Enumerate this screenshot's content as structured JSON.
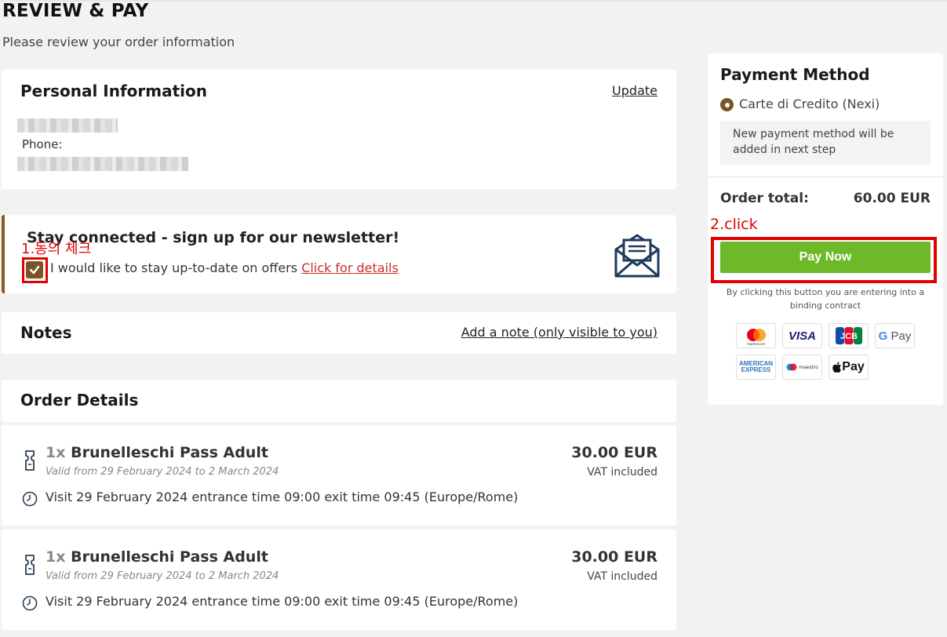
{
  "page": {
    "title": "REVIEW & PAY",
    "subtitle": "Please review your order information"
  },
  "personal": {
    "title": "Personal Information",
    "update_link": "Update",
    "phone_label": "Phone:"
  },
  "newsletter": {
    "title": "Stay connected - sign up for our newsletter!",
    "checkbox_text": "I would like to stay up-to-date on offers",
    "details_link": "Click for details",
    "checked": true
  },
  "notes": {
    "title": "Notes",
    "add_link": "Add a note (only visible to you)"
  },
  "order": {
    "title": "Order Details",
    "items": [
      {
        "qty": "1x",
        "name": "Brunelleschi Pass Adult",
        "validity": "Valid from 29 February 2024 to 2 March 2024",
        "price": "30.00 EUR",
        "vat": "VAT included",
        "visit": "Visit 29 February 2024 entrance time 09:00 exit time 09:45 (Europe/Rome)"
      },
      {
        "qty": "1x",
        "name": "Brunelleschi Pass Adult",
        "validity": "Valid from 29 February 2024 to 2 March 2024",
        "price": "30.00 EUR",
        "vat": "VAT included",
        "visit": "Visit 29 February 2024 entrance time 09:00 exit time 09:45 (Europe/Rome)"
      }
    ]
  },
  "payment": {
    "title": "Payment Method",
    "option": "Carte di Credito (Nexi)",
    "note": "New payment method will be added in next step",
    "total_label": "Order total:",
    "total_value": "60.00 EUR",
    "pay_button": "Pay Now",
    "pay_note": "By clicking this button you are entering into a binding contract",
    "logos": {
      "mastercard_small": "mastercard",
      "visa": "VISA",
      "jcb": "JCB",
      "gpay_g": "G",
      "gpay_text": "Pay",
      "amex_line1": "AMERICAN",
      "amex_line2": "EXPRESS",
      "maestro": "maestro",
      "apple_pay": "Pay"
    }
  },
  "annotations": {
    "step1": "1.동의 체크",
    "step2": "2.click"
  },
  "colors": {
    "accent_brown": "#7a5427",
    "pay_green": "#6fb82a",
    "annotation_red": "#e30000",
    "link_red": "#cc2a2a"
  }
}
